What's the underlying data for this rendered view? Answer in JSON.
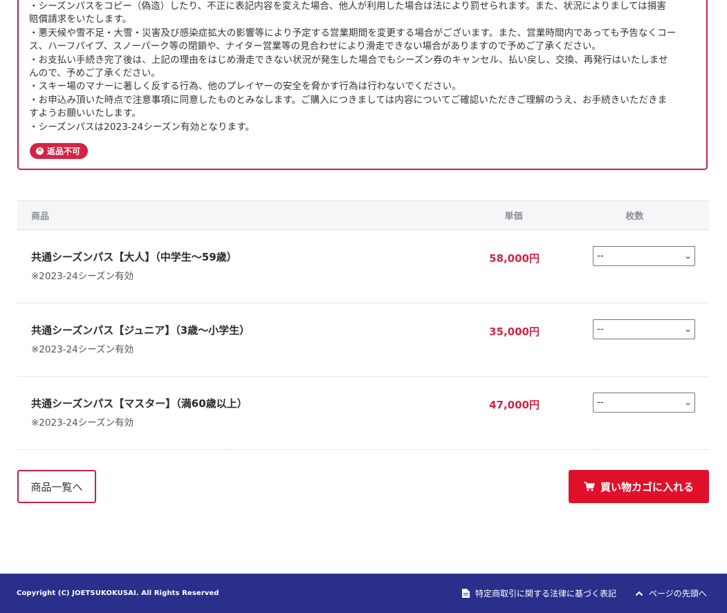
{
  "notice": {
    "lines": [
      "・シーズンパスをコピー（偽造）したり、不正に表記内容を変えた場合、他人が利用した場合は法により罰せられます。また、状況によりましては損害",
      "賠償請求をいたします。",
      "・悪天候や雪不足・大雪・災害及び感染症拡大の影響等により予定する営業期間を変更する場合がございます。また、営業時間内であっても予告なくコー",
      "ス、ハーフパイプ、スノーパーク等の閉鎖や、ナイター営業等の見合わせにより滑走できない場合がありますので予めご了承ください。",
      "・お支払い手続き完了後は、上記の理由をはじめ滑走できない状況が発生した場合でもシーズン券のキャンセル、払い戻し、交換、再発行はいたしませ",
      "んので、予めご了承ください。",
      "・スキー場のマナーに著しく反する行為、他のプレイヤーの安全を脅かす行為は行わないでください。",
      "・お申込み頂いた時点で注意事項に同意したものとみなします。ご購入につきましては内容についてご確認いただきご理解のうえ、お手続きいただきま",
      "すようお願いいたします。",
      "・シーズンパスは2023-24シーズン有効となります。"
    ],
    "badge": "返品不可"
  },
  "table": {
    "headers": {
      "product": "商品",
      "price": "単価",
      "qty": "枚数"
    },
    "rows": [
      {
        "name": "共通シーズンパス【大人】（中学生～59歳）",
        "note": "※2023-24シーズン有効",
        "price": "58,000円",
        "qty": "--"
      },
      {
        "name": "共通シーズンパス【ジュニア】（3歳～小学生）",
        "note": "※2023-24シーズン有効",
        "price": "35,000円",
        "qty": "--"
      },
      {
        "name": "共通シーズンパス【マスター】（満60歳以上）",
        "note": "※2023-24シーズン有効",
        "price": "47,000円",
        "qty": "--"
      }
    ]
  },
  "buttons": {
    "back": "商品一覧へ",
    "cart": "買い物カゴに入れる"
  },
  "footer": {
    "copyright": "Copyright (C) JOETSUKOKUSAI. All Rights Reserved",
    "law_link": "特定商取引に関する法律に基づく表記",
    "top_link": "ページの先頭へ"
  },
  "colors": {
    "accent": "#d42443",
    "cart_button": "#e0102b",
    "footer_bg": "#2b2f8c"
  },
  "icons": {
    "badge": "times-circle-icon",
    "cart": "cart-icon",
    "document": "document-icon",
    "chevron_up": "chevron-up-icon",
    "select": "chevron-down-icon"
  }
}
